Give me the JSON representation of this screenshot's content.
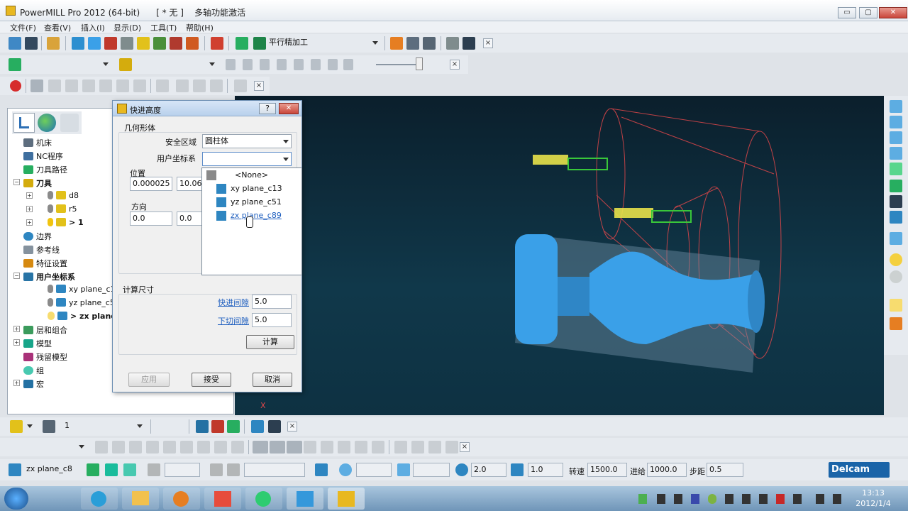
{
  "window": {
    "title": "PowerMILL Pro 2012 (64-bit)      [ * 无 ]    多轴功能激活",
    "minimize": "▭",
    "maximize": "▢",
    "close": "✕"
  },
  "menu": [
    "文件(F)",
    "查看(V)",
    "插入(I)",
    "显示(D)",
    "工具(T)",
    "帮助(H)"
  ],
  "toolbar1": {
    "strategy_combo": "平行精加工",
    "close": "×"
  },
  "toolbar2": {
    "close": "×"
  },
  "toolbar3": {
    "close": "×"
  },
  "explorer": {
    "items": [
      {
        "label": "机床"
      },
      {
        "label": "NC程序"
      },
      {
        "label": "刀具路径"
      },
      {
        "label": "刀具"
      },
      {
        "label": "d8"
      },
      {
        "label": "r5"
      },
      {
        "label": "> 1"
      },
      {
        "label": "边界"
      },
      {
        "label": "参考线"
      },
      {
        "label": "特征设置"
      },
      {
        "label": "用户坐标系"
      },
      {
        "label": "xy plane_c1"
      },
      {
        "label": "yz plane_c5"
      },
      {
        "label": "> zx plane"
      },
      {
        "label": "层和组合"
      },
      {
        "label": "模型"
      },
      {
        "label": "残留模型"
      },
      {
        "label": "组"
      },
      {
        "label": "宏"
      }
    ]
  },
  "dialog": {
    "title": "快进高度",
    "help": "?",
    "close": "✕",
    "geometry_group": "几何形体",
    "safe_area_label": "安全区域",
    "safe_area_value": "圆柱体",
    "ucs_label": "用户坐标系",
    "ucs_value": "",
    "position_label": "位置",
    "position_x": "0.000025",
    "position_y": "10.062",
    "direction_label": "方向",
    "direction_x": "0.0",
    "direction_y": "0.0",
    "calc_group": "计算尺寸",
    "rapid_gap_label": "快进间隙",
    "rapid_gap_value": "5.0",
    "plunge_gap_label": "下切间隙",
    "plunge_gap_value": "5.0",
    "calc_button": "计算",
    "apply_button": "应用",
    "accept_button": "接受",
    "cancel_button": "取消",
    "ucs_options": [
      "<None>",
      "xy plane_c13",
      "yz plane_c51",
      "zx plane_c89"
    ]
  },
  "bottombar1": {
    "tool_combo": "1",
    "close": "×"
  },
  "bottombar2": {
    "close": "×"
  },
  "statusbar": {
    "ucs_combo": "zx plane_c8",
    "value1": "2.0",
    "value2": "1.0",
    "spindle_label": "转速",
    "spindle_value": "1500.0",
    "feed_label": "进给",
    "feed_value": "1000.0",
    "step_label": "步距",
    "step_value": "0.5",
    "brand": "Delcam"
  },
  "viewport": {
    "axis_label": "X"
  },
  "taskbar": {
    "time": "13:13",
    "date": "2012/1/4"
  },
  "colors": {
    "accent": "#2a9ed8",
    "part_blue": "#3aa0e8",
    "tool_yellow": "#e8e24a",
    "tool_green": "#39c63a",
    "wire_red": "#e0474a"
  }
}
